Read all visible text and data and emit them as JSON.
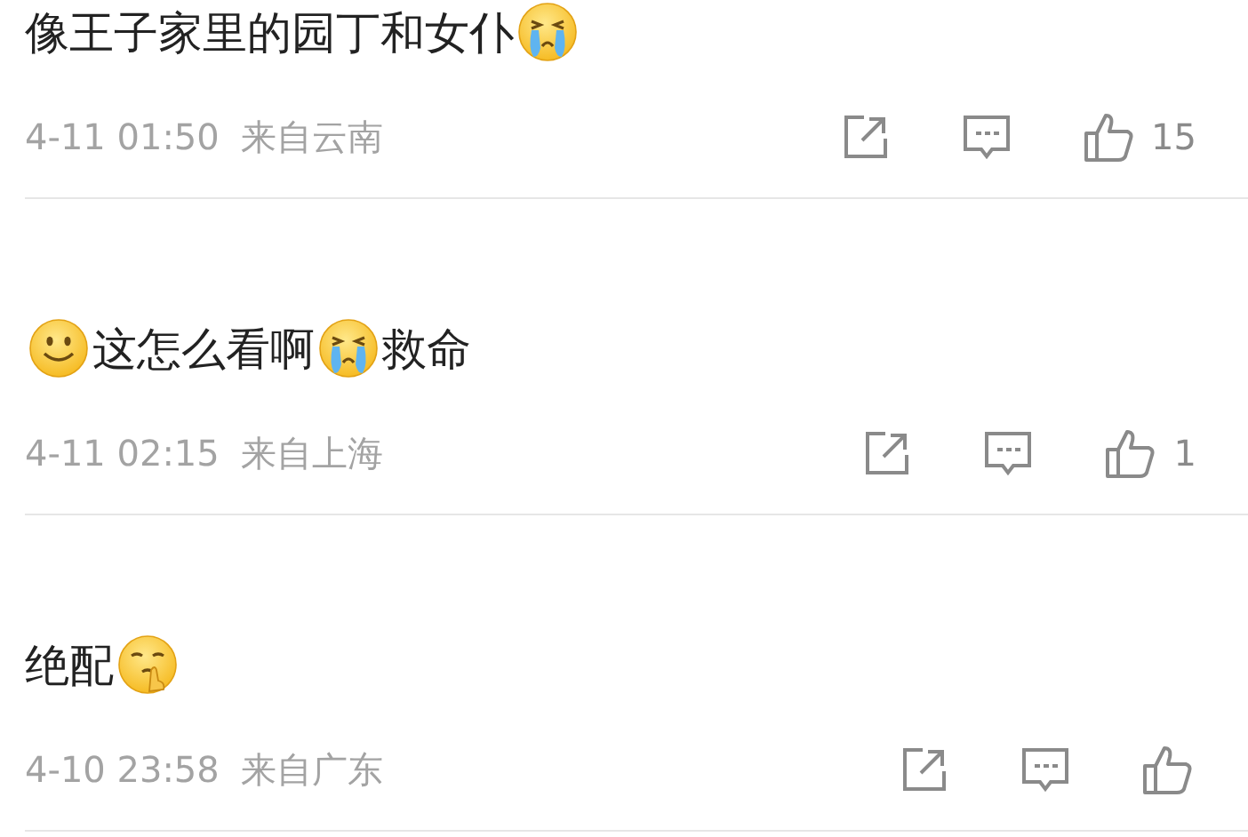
{
  "comments": [
    {
      "content": [
        {
          "kind": "text",
          "text": "像王子家里的园丁和女仆"
        },
        {
          "kind": "cry-emoji"
        }
      ],
      "time": "4-11 01:50",
      "location": "来自云南",
      "likes": "15"
    },
    {
      "content": [
        {
          "kind": "smile-emoji"
        },
        {
          "kind": "text",
          "text": "这怎么看啊"
        },
        {
          "kind": "cry-emoji"
        },
        {
          "kind": "text",
          "text": "救命"
        }
      ],
      "time": "4-11 02:15",
      "location": "来自上海",
      "likes": "1"
    },
    {
      "content": [
        {
          "kind": "text",
          "text": "绝配"
        },
        {
          "kind": "shush-emoji"
        }
      ],
      "time": "4-10 23:58",
      "location": "来自广东"
    }
  ]
}
